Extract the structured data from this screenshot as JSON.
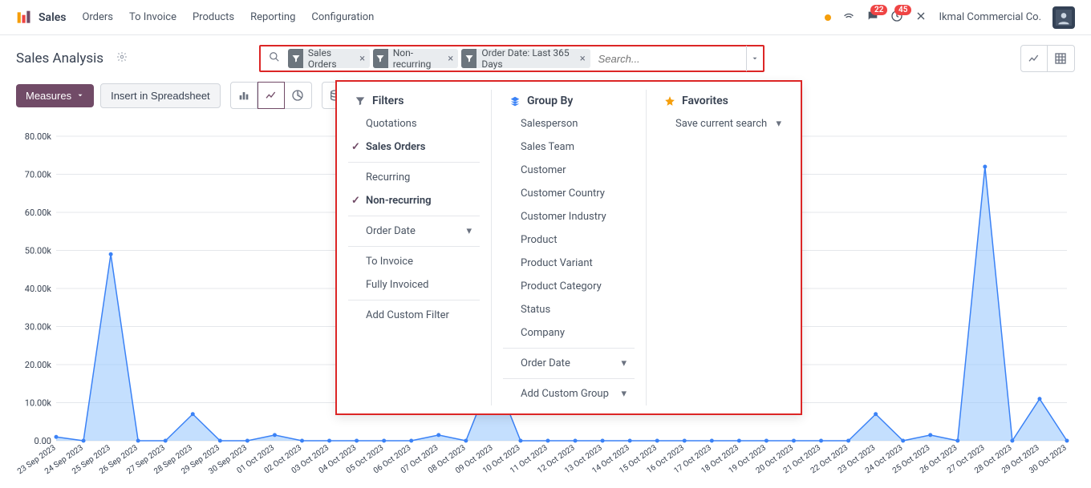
{
  "app": {
    "name": "Sales"
  },
  "nav": {
    "items": [
      "Orders",
      "To Invoice",
      "Products",
      "Reporting",
      "Configuration"
    ],
    "badges": {
      "messages": "22",
      "activities": "45"
    },
    "company": "Ikmal Commercial Co."
  },
  "page": {
    "title": "Sales Analysis"
  },
  "search": {
    "chips": [
      {
        "label": "Sales Orders"
      },
      {
        "label": "Non-recurring"
      },
      {
        "label": "Order Date: Last 365 Days"
      }
    ],
    "placeholder": "Search..."
  },
  "toolbar": {
    "measures": "Measures",
    "insert": "Insert in Spreadsheet"
  },
  "dropdown": {
    "filters": {
      "header": "Filters",
      "items1": [
        {
          "label": "Quotations",
          "checked": false
        },
        {
          "label": "Sales Orders",
          "checked": true
        }
      ],
      "items2": [
        {
          "label": "Recurring",
          "checked": false
        },
        {
          "label": "Non-recurring",
          "checked": true
        }
      ],
      "orderDate": "Order Date",
      "items3": [
        {
          "label": "To Invoice"
        },
        {
          "label": "Fully Invoiced"
        }
      ],
      "addCustom": "Add Custom Filter"
    },
    "groupBy": {
      "header": "Group By",
      "items": [
        "Salesperson",
        "Sales Team",
        "Customer",
        "Customer Country",
        "Customer Industry",
        "Product",
        "Product Variant",
        "Product Category",
        "Status",
        "Company"
      ],
      "orderDate": "Order Date",
      "addCustom": "Add Custom Group"
    },
    "favorites": {
      "header": "Favorites",
      "save": "Save current search"
    }
  },
  "chart_data": {
    "type": "area",
    "title": "",
    "xlabel": "",
    "ylabel": "",
    "ylim": [
      0,
      80000
    ],
    "yticks": [
      0,
      10000,
      20000,
      30000,
      40000,
      50000,
      60000,
      70000,
      80000
    ],
    "ytick_labels": [
      "0.00",
      "10.00k",
      "20.00k",
      "30.00k",
      "40.00k",
      "50.00k",
      "60.00k",
      "70.00k",
      "80.00k"
    ],
    "categories": [
      "23 Sep 2023",
      "24 Sep 2023",
      "25 Sep 2023",
      "26 Sep 2023",
      "27 Sep 2023",
      "28 Sep 2023",
      "29 Sep 2023",
      "30 Sep 2023",
      "01 Oct 2023",
      "02 Oct 2023",
      "03 Oct 2023",
      "04 Oct 2023",
      "05 Oct 2023",
      "06 Oct 2023",
      "07 Oct 2023",
      "08 Oct 2023",
      "09 Oct 2023",
      "10 Oct 2023",
      "11 Oct 2023",
      "12 Oct 2023",
      "13 Oct 2023",
      "14 Oct 2023",
      "15 Oct 2023",
      "16 Oct 2023",
      "17 Oct 2023",
      "18 Oct 2023",
      "19 Oct 2023",
      "20 Oct 2023",
      "21 Oct 2023",
      "22 Oct 2023",
      "23 Oct 2023",
      "24 Oct 2023",
      "25 Oct 2023",
      "26 Oct 2023",
      "27 Oct 2023",
      "28 Oct 2023",
      "29 Oct 2023",
      "30 Oct 2023"
    ],
    "values": [
      1000,
      0,
      49000,
      0,
      0,
      7000,
      0,
      0,
      1500,
      0,
      0,
      0,
      0,
      0,
      1500,
      0,
      18000,
      0,
      0,
      0,
      0,
      0,
      0,
      0,
      0,
      0,
      0,
      0,
      0,
      0,
      7000,
      0,
      1500,
      0,
      72000,
      0,
      11000,
      0
    ]
  }
}
